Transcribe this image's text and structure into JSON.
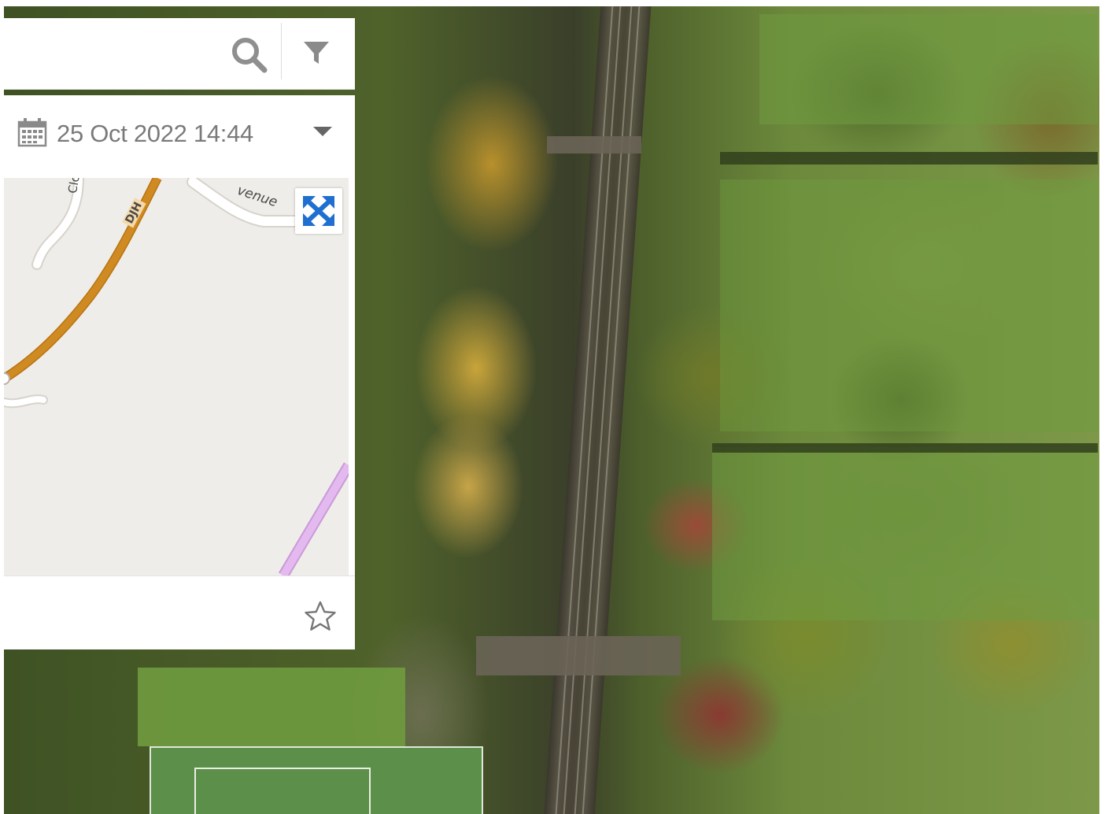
{
  "search": {
    "value": "",
    "placeholder": ""
  },
  "icons": {
    "search": "search-icon",
    "filter": "filter-icon",
    "calendar": "calendar-icon",
    "caret": "chevron-down-icon",
    "expand": "expand-icon",
    "star": "star-icon"
  },
  "date": {
    "value": "25 Oct 2022 14:44"
  },
  "minimap": {
    "labels": {
      "road_a": "Clou",
      "road_b": "DJH",
      "road_c": "venue"
    }
  },
  "colors": {
    "panel_bg": "#ffffff",
    "icon_grey": "#8a8a8a",
    "expand_blue": "#1f6fd1",
    "road_main": "#d08a22",
    "road_pink": "#e3b9ef"
  }
}
